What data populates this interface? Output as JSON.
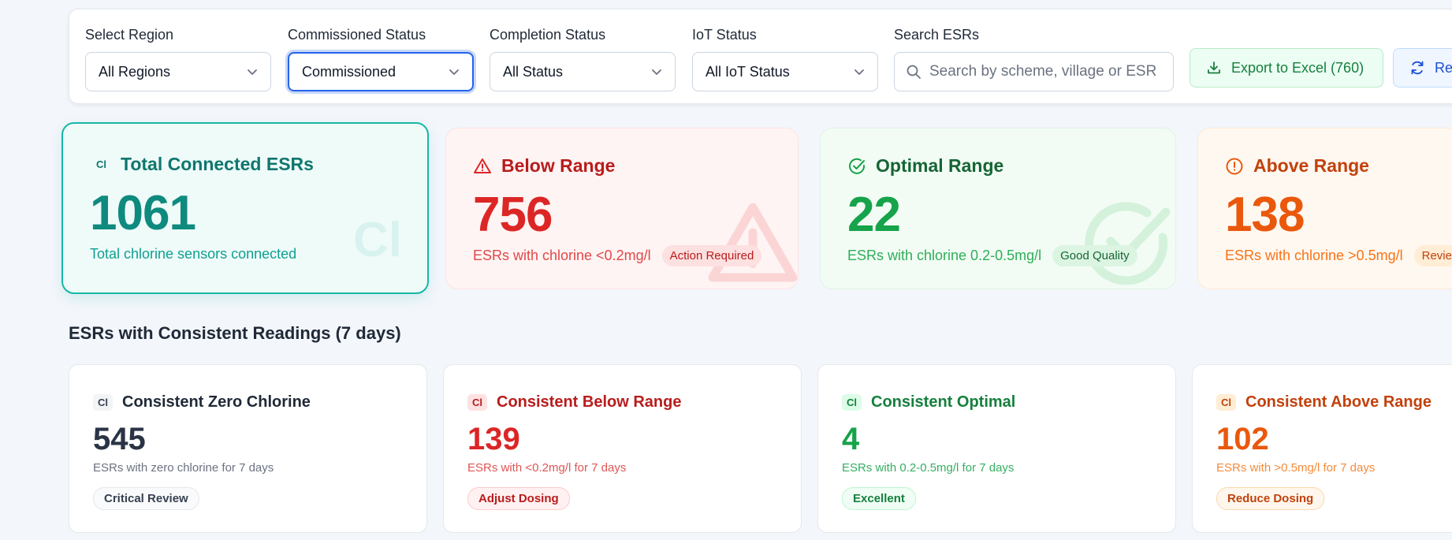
{
  "filters": {
    "region": {
      "label": "Select Region",
      "value": "All Regions"
    },
    "commissioned": {
      "label": "Commissioned Status",
      "value": "Commissioned"
    },
    "completion": {
      "label": "Completion Status",
      "value": "All Status"
    },
    "iot": {
      "label": "IoT Status",
      "value": "All IoT Status"
    },
    "search": {
      "label": "Search ESRs",
      "placeholder": "Search by scheme, village or ESR..."
    }
  },
  "actions": {
    "export_label": "Export to Excel (760)",
    "refresh_label": "Refresh"
  },
  "stats": {
    "total": {
      "badge": "Cl",
      "title": "Total Connected ESRs",
      "value": "1061",
      "subtitle": "Total chlorine sensors connected",
      "watermark": "Cl"
    },
    "below": {
      "title": "Below Range",
      "value": "756",
      "subtitle": "ESRs with chlorine <0.2mg/l",
      "pill": "Action Required"
    },
    "optimal": {
      "title": "Optimal Range",
      "value": "22",
      "subtitle": "ESRs with chlorine 0.2-0.5mg/l",
      "pill": "Good Quality"
    },
    "above": {
      "title": "Above Range",
      "value": "138",
      "subtitle": "ESRs with chlorine >0.5mg/l",
      "pill": "Review"
    }
  },
  "consistent": {
    "section_title": "ESRs with Consistent Readings (7 days)",
    "zero": {
      "badge": "Cl",
      "title": "Consistent Zero Chlorine",
      "value": "545",
      "subtitle": "ESRs with zero chlorine for 7 days",
      "pill": "Critical Review"
    },
    "below": {
      "badge": "Cl",
      "title": "Consistent Below Range",
      "value": "139",
      "subtitle": "ESRs with <0.2mg/l for 7 days",
      "pill": "Adjust Dosing"
    },
    "optimal": {
      "badge": "Cl",
      "title": "Consistent Optimal",
      "value": "4",
      "subtitle": "ESRs with 0.2-0.5mg/l for 7 days",
      "pill": "Excellent"
    },
    "above": {
      "badge": "Cl",
      "title": "Consistent Above Range",
      "value": "102",
      "subtitle": "ESRs with >0.5mg/l for 7 days",
      "pill": "Reduce Dosing"
    }
  },
  "icons": {
    "chevron": "chevron-down-icon",
    "search": "search-icon",
    "export": "download-icon",
    "refresh": "refresh-icon",
    "below": "alert-triangle-icon",
    "optimal": "check-circle-icon",
    "above": "alert-circle-icon"
  },
  "colors": {
    "teal": "#14b8a6",
    "red": "#dc2626",
    "green": "#16a34a",
    "orange": "#ea580c",
    "focus_blue": "#2563eb"
  }
}
